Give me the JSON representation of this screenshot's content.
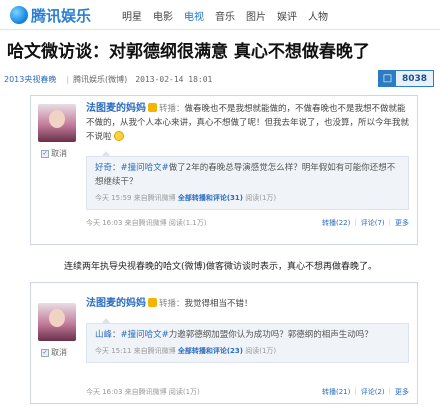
{
  "header": {
    "logo": "腾讯娱乐",
    "nav": [
      "明星",
      "电影",
      "电视",
      "音乐",
      "图片",
      "娱评",
      "人物"
    ],
    "active_nav": 2
  },
  "article": {
    "title": "哈文微访谈：对郭德纲很满意 真心不想做春晚了",
    "channel": "2013央视春晚",
    "source": "腾讯娱乐(微博)",
    "datetime": "2013-02-14 18:01",
    "count": "8038"
  },
  "post1": {
    "author": "法图麦的妈妈",
    "label": "转播：",
    "text": "做春晚也不是我想就能做的，不做春晚也不是我想不做就能不做的，从我个人本心来讲，真心不想做了呢！但我去年说了，也没算，所以今年我就不说啦",
    "unfollow": "取消",
    "quote_user": "好奇",
    "quote_topic": "#撞问哈文#",
    "quote_text": "做了2年的春晚总导演感觉怎么样？明年假如有可能你还想不想继续干？",
    "quote_time": "今天 15:59 来自腾讯微博",
    "quote_link": "全部转播和评论(31)",
    "quote_read": "阅读(1万)",
    "time": "今天 16:03 来自腾讯微博",
    "read": "阅读(1.1万)",
    "forward": "转播(22)",
    "comment": "评论(7)",
    "more": "更多"
  },
  "middle_text": "连续两年执导央视春晚的哈文(微博)做客微访谈时表示，真心不想再做春晚了。",
  "post2": {
    "author": "法图麦的妈妈",
    "label": "转播：",
    "text": "我觉得相当不错！",
    "unfollow": "取消",
    "quote_user": "山峰",
    "quote_topic": "#撞问哈文#",
    "quote_text": "力邀郭德纲加盟你认为成功吗？郭德纲的相声生动吗？",
    "quote_time": "今天 15:11 来自腾讯微博",
    "quote_link": "全部转播和评论(23)",
    "quote_read": "阅读(1万)",
    "time": "今天 16:03 来自腾讯微博",
    "read": "阅读(1万)",
    "forward": "转播(21)",
    "comment": "评论(2)",
    "more": "更多"
  }
}
